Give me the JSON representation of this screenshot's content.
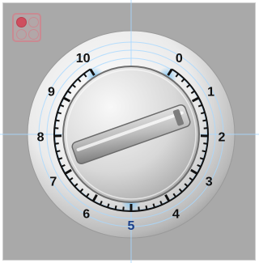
{
  "control": {
    "mode_indicator": {
      "leds_on": [
        true,
        false,
        false,
        false
      ]
    },
    "dial": {
      "labels": [
        "0",
        "1",
        "2",
        "3",
        "4",
        "5",
        "6",
        "7",
        "8",
        "9",
        "10"
      ],
      "value": 1.3,
      "min": 0,
      "max": 10
    },
    "colors": {
      "panel": "#a9a9a9",
      "guide_line": "#a8d8ff",
      "highlight": "#73c2f5",
      "tick": "#111111",
      "led_on": "#cf4f5f",
      "led_off_border": "#c98a92"
    }
  }
}
